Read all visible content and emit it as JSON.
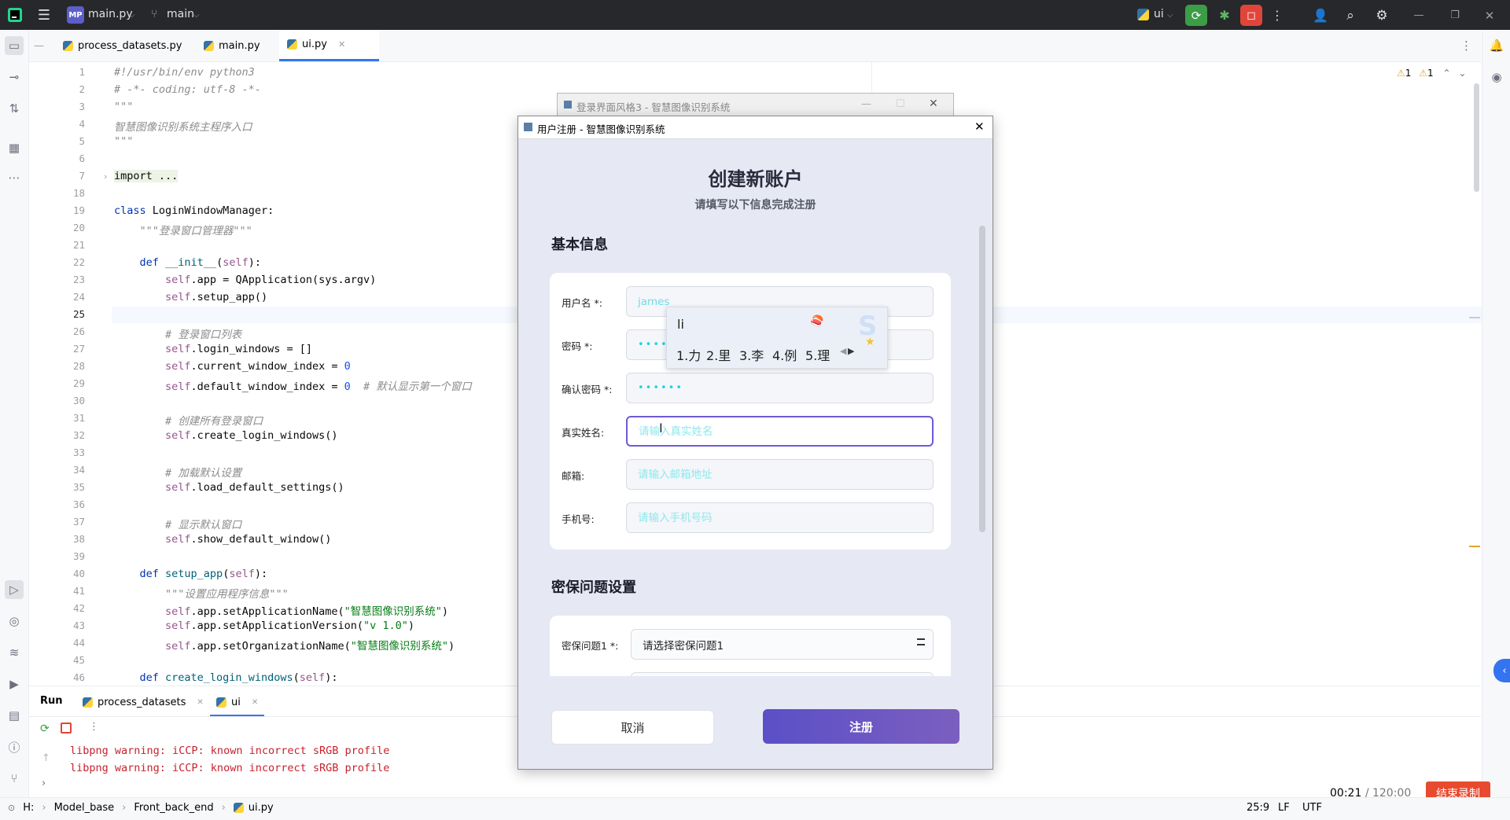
{
  "titlebar": {
    "project_badge": "MP",
    "project_name": "main.py",
    "branch": "main",
    "run_config": "ui"
  },
  "tabs": [
    {
      "label": "process_datasets.py"
    },
    {
      "label": "main.py"
    },
    {
      "label": "ui.py",
      "active": true
    }
  ],
  "editor": {
    "inspection_warnings": "1",
    "inspection_weak": "1",
    "lines": [
      {
        "n": "1",
        "text": "#!/usr/bin/env python3"
      },
      {
        "n": "2",
        "text": "# -*- coding: utf-8 -*-"
      },
      {
        "n": "3",
        "text": "\"\"\""
      },
      {
        "n": "4",
        "text": "智慧图像识别系统主程序入口"
      },
      {
        "n": "5",
        "text": "\"\"\""
      },
      {
        "n": "6",
        "text": ""
      },
      {
        "n": "7",
        "text": "import ..."
      },
      {
        "n": "18",
        "text": ""
      },
      {
        "n": "19",
        "text": "class LoginWindowManager:"
      },
      {
        "n": "20",
        "text": "    \"\"\"登录窗口管理器\"\"\""
      },
      {
        "n": "21",
        "text": ""
      },
      {
        "n": "22",
        "text": "    def __init__(self):"
      },
      {
        "n": "23",
        "text": "        self.app = QApplication(sys.argv)"
      },
      {
        "n": "24",
        "text": "        self.setup_app()"
      },
      {
        "n": "25",
        "text": ""
      },
      {
        "n": "26",
        "text": "        # 登录窗口列表"
      },
      {
        "n": "27",
        "text": "        self.login_windows = []"
      },
      {
        "n": "28",
        "text": "        self.current_window_index = 0"
      },
      {
        "n": "29",
        "text": "        self.default_window_index = 0  # 默认显示第一个窗口"
      },
      {
        "n": "30",
        "text": ""
      },
      {
        "n": "31",
        "text": "        # 创建所有登录窗口"
      },
      {
        "n": "32",
        "text": "        self.create_login_windows()"
      },
      {
        "n": "33",
        "text": ""
      },
      {
        "n": "34",
        "text": "        # 加载默认设置"
      },
      {
        "n": "35",
        "text": "        self.load_default_settings()"
      },
      {
        "n": "36",
        "text": ""
      },
      {
        "n": "37",
        "text": "        # 显示默认窗口"
      },
      {
        "n": "38",
        "text": "        self.show_default_window()"
      },
      {
        "n": "39",
        "text": ""
      },
      {
        "n": "40",
        "text": "    def setup_app(self):"
      },
      {
        "n": "41",
        "text": "        \"\"\"设置应用程序信息\"\"\""
      },
      {
        "n": "42",
        "text": "        self.app.setApplicationName(\"智慧图像识别系统\")"
      },
      {
        "n": "43",
        "text": "        self.app.setApplicationVersion(\"v 1.0\")"
      },
      {
        "n": "44",
        "text": "        self.app.setOrganizationName(\"智慧图像识别系统\")"
      },
      {
        "n": "45",
        "text": ""
      },
      {
        "n": "46",
        "text": "    def create_login_windows(self):"
      }
    ]
  },
  "run_panel": {
    "title": "Run",
    "tabs": [
      "process_datasets",
      "ui"
    ],
    "output": [
      "libpng warning: iCCP: known incorrect sRGB profile",
      "libpng warning: iCCP: known incorrect sRGB profile"
    ]
  },
  "statusbar": {
    "breadcrumb": [
      "H:",
      "Model_base",
      "Front_back_end",
      "ui.py"
    ],
    "position": "25:9",
    "line_sep": "LF",
    "encoding": "UTF",
    "timer": "00:21",
    "timer_total": "/ 120:00",
    "stop_record": "结束录制"
  },
  "bg_window": {
    "title": "登录界面风格3 - 智慧图像识别系统"
  },
  "dialog": {
    "title": "用户注册 - 智慧图像识别系统",
    "heading": "创建新账户",
    "subheading": "请填写以下信息完成注册",
    "section_basic": "基本信息",
    "fields": {
      "username_label": "用户名 *:",
      "username_value": "james",
      "password_label": "密码 *:",
      "password_value": "••••",
      "confirm_label": "确认密码 *:",
      "confirm_value": "••••••",
      "realname_label": "真实姓名:",
      "realname_placeholder": "请输入真实姓名",
      "email_label": "邮箱:",
      "email_placeholder": "请输入邮箱地址",
      "phone_label": "手机号:",
      "phone_placeholder": "请输入手机号码"
    },
    "section_security": "密保问题设置",
    "security_q1_label": "密保问题1 *:",
    "security_q1_value": "请选择密保问题1",
    "cancel": "取消",
    "register": "注册"
  },
  "ime": {
    "composition": "li",
    "candidates": [
      "1.力",
      "2.里",
      "3.李",
      "4.例",
      "5.理"
    ]
  },
  "colors": {
    "accent_purple": "#6c5ad6",
    "input_text_cyan": "#21d6de",
    "stop_button_red": "#e84a2f"
  }
}
